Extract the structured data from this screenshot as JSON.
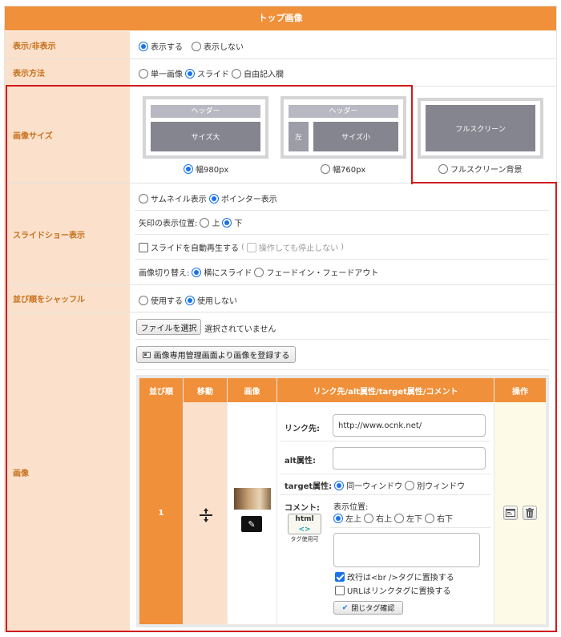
{
  "header": {
    "title": "トップ画像"
  },
  "rows": {
    "visibility": {
      "label": "表示/非表示",
      "options": [
        "表示する",
        "表示しない"
      ],
      "selected": 0
    },
    "display_method": {
      "label": "表示方法",
      "options": [
        "単一画像",
        "スライド",
        "自由記入欄"
      ],
      "selected": 1
    },
    "image_size": {
      "label": "画像サイズ",
      "options": [
        {
          "label": "幅980px",
          "header": "ヘッダー",
          "body": "サイズ大"
        },
        {
          "label": "幅760px",
          "header": "ヘッダー",
          "side": "左",
          "body": "サイズ小"
        },
        {
          "label": "フルスクリーン背景",
          "body": "フルスクリーン"
        }
      ],
      "selected": 0
    },
    "slideshow": {
      "label": "スライドショー表示",
      "mode_options": [
        "サムネイル表示",
        "ポインター表示"
      ],
      "mode_selected": 1,
      "arrow_label": "矢印の表示位置:",
      "arrow_options": [
        "上",
        "下"
      ],
      "arrow_selected": 1,
      "autoplay_label": "スライドを自動再生する",
      "autoplay_checked": false,
      "nostop_label": "操作しても停止しない",
      "nostop_checked": false,
      "switch_label": "画像切り替え:",
      "switch_options": [
        "横にスライド",
        "フェードイン・フェードアウト"
      ],
      "switch_selected": 0
    },
    "shuffle": {
      "label": "並び順をシャッフル",
      "options": [
        "使用する",
        "使用しない"
      ],
      "selected": 1
    },
    "images": {
      "label": "画像",
      "file_button": "ファイルを選択",
      "file_status": "選択されていません",
      "register_button": "画像専用管理画面より画像を登録する",
      "table": {
        "headers": [
          "並び順",
          "移動",
          "画像",
          "リンク先/alt属性/target属性/コメント",
          "操作"
        ],
        "row": {
          "order": "1",
          "link_label": "リンク先:",
          "link_value": "http://www.ocnk.net/",
          "alt_label": "alt属性:",
          "alt_value": "",
          "target_label": "target属性:",
          "target_options": [
            "同一ウィンドウ",
            "別ウィンドウ"
          ],
          "target_selected": 0,
          "comment_label": "コメント:",
          "html_badge_top": "html",
          "html_badge_bottom": "タグ使用可",
          "position_label": "表示位置:",
          "position_options": [
            "左上",
            "右上",
            "左下",
            "右下"
          ],
          "position_selected": 0,
          "comment_value": "",
          "br_label": "改行は<br />タグに置換する",
          "br_checked": true,
          "url_label": "URLはリンクタグに置換する",
          "url_checked": false,
          "check_button": "閉じタグ確認"
        }
      }
    }
  },
  "colors": {
    "accent": "#f0903a",
    "label_bg": "#fbe1cc",
    "label_text": "#c8711d",
    "highlight": "#d01b1b",
    "radio_blue": "#1a73e8"
  }
}
